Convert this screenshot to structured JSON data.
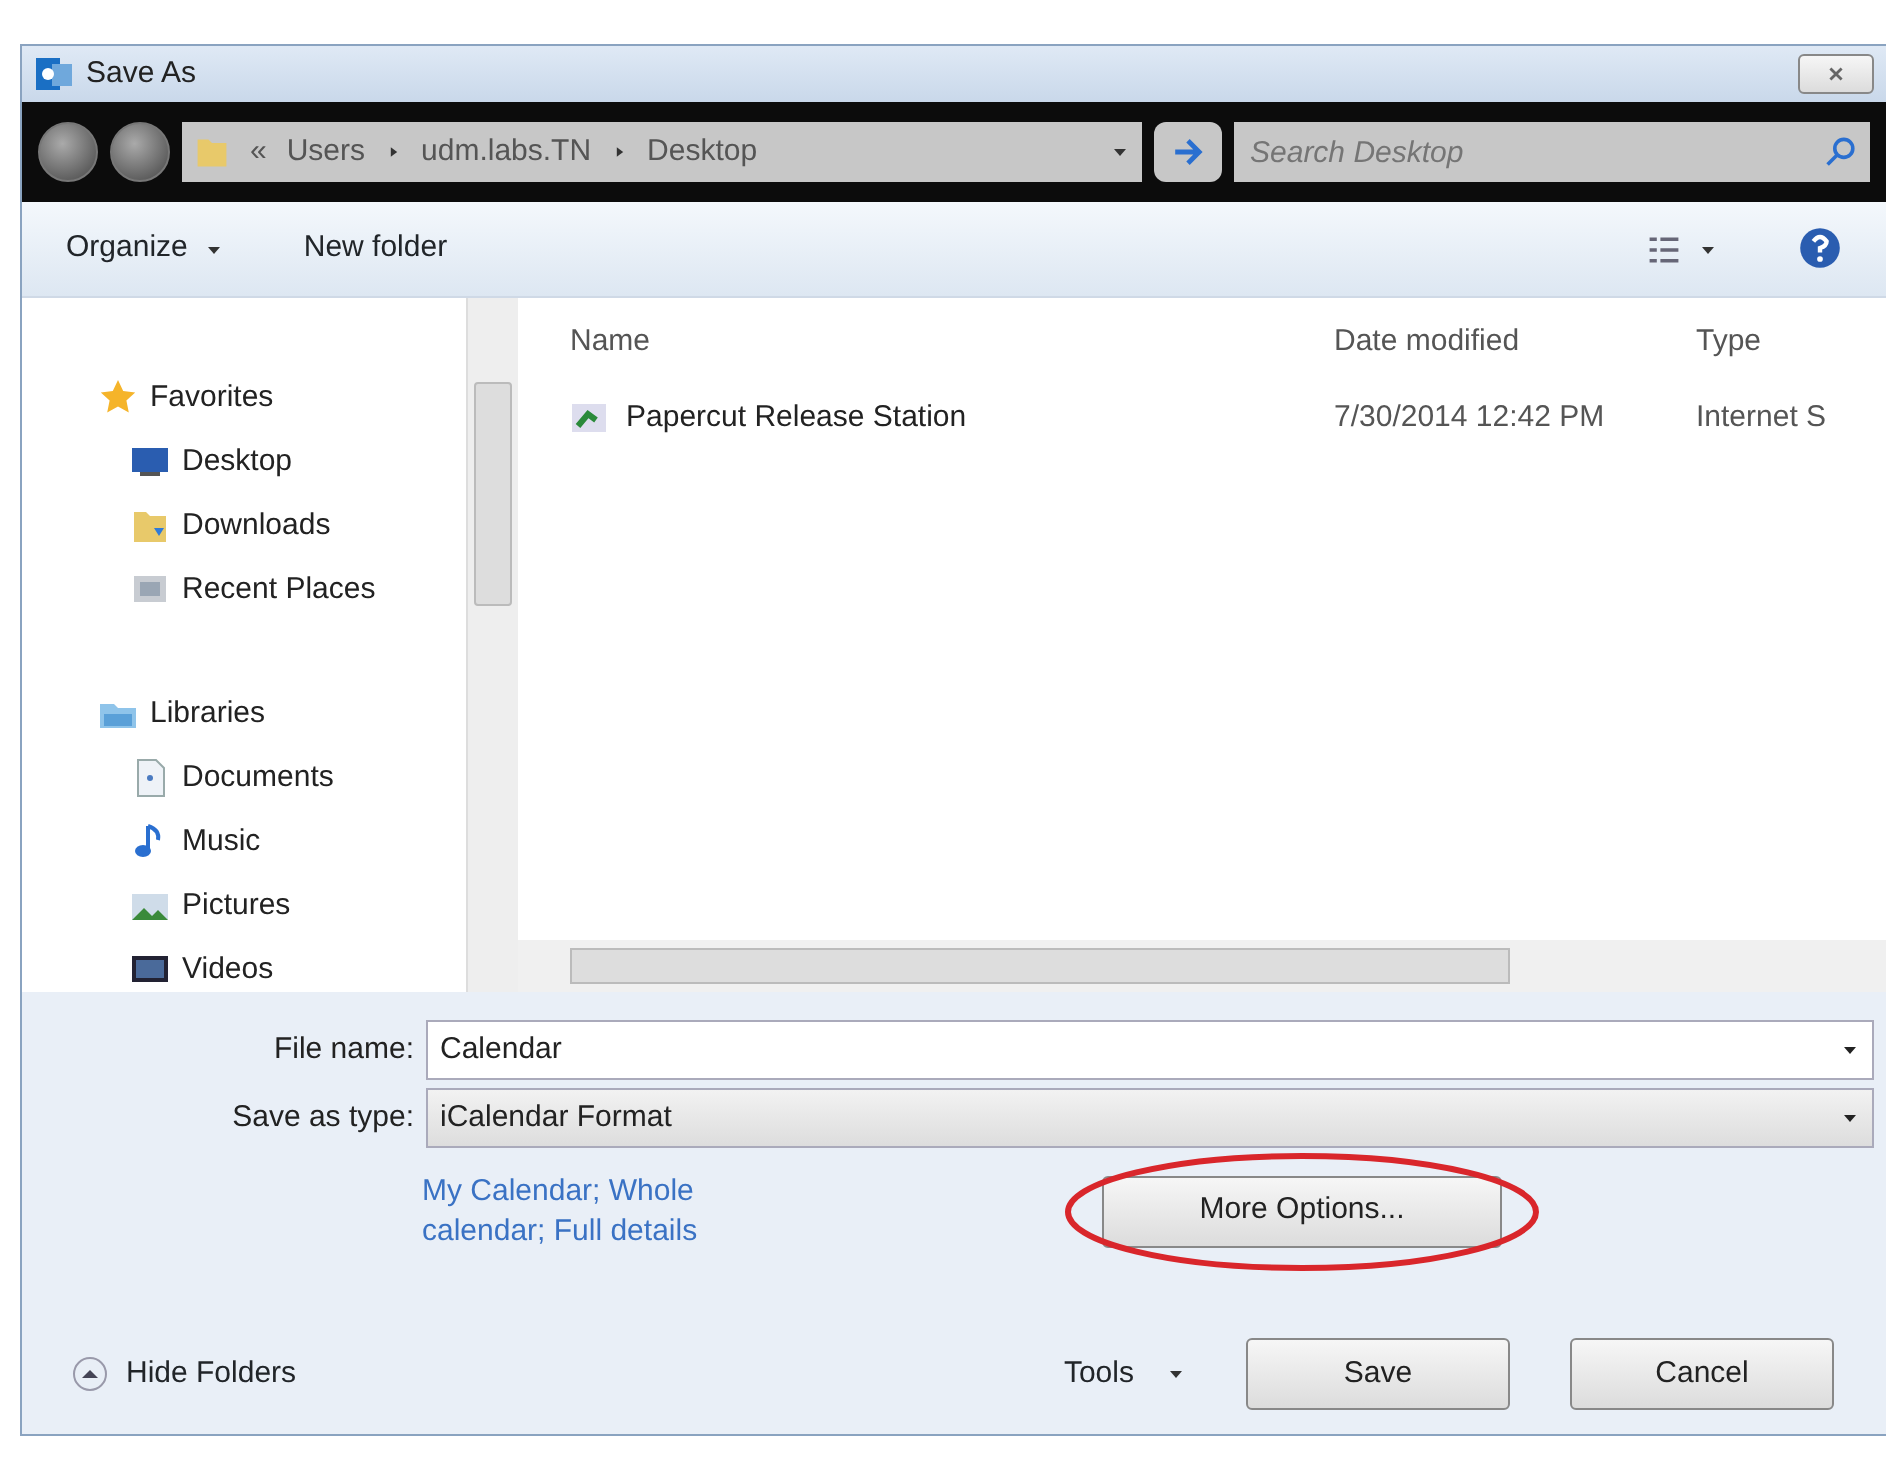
{
  "window": {
    "title": "Save As"
  },
  "address_bar": {
    "path": [
      {
        "label": "«"
      },
      {
        "label": "Users"
      },
      {
        "label": "udm.labs.TN"
      },
      {
        "label": "Desktop"
      }
    ],
    "search_placeholder": "Search Desktop"
  },
  "toolbar": {
    "organize": "Organize",
    "new_folder": "New folder"
  },
  "sidebar": {
    "groups": [
      {
        "label": "Favorites",
        "kind": "star",
        "children": [
          {
            "label": "Desktop",
            "kind": "desktop"
          },
          {
            "label": "Downloads",
            "kind": "downloads"
          },
          {
            "label": "Recent Places",
            "kind": "recent"
          }
        ]
      },
      {
        "label": "Libraries",
        "kind": "library",
        "children": [
          {
            "label": "Documents",
            "kind": "document"
          },
          {
            "label": "Music",
            "kind": "music"
          },
          {
            "label": "Pictures",
            "kind": "pictures"
          },
          {
            "label": "Videos",
            "kind": "videos"
          }
        ]
      }
    ]
  },
  "table": {
    "columns": [
      "Name",
      "Date modified",
      "Type"
    ],
    "rows": [
      {
        "name": "Papercut Release Station",
        "date": "7/30/2014 12:42 PM",
        "type": "Internet S"
      }
    ]
  },
  "form": {
    "file_name_label": "File name:",
    "file_name": "Calendar",
    "type_label": "Save as type:",
    "type_value": "iCalendar Format"
  },
  "details_link": "My Calendar; Whole calendar; Full details",
  "more_options": {
    "label": "More Options...",
    "highlighted": true
  },
  "footer": {
    "hide_folders": "Hide Folders",
    "tools": "Tools",
    "save": "Save",
    "cancel": "Cancel"
  }
}
